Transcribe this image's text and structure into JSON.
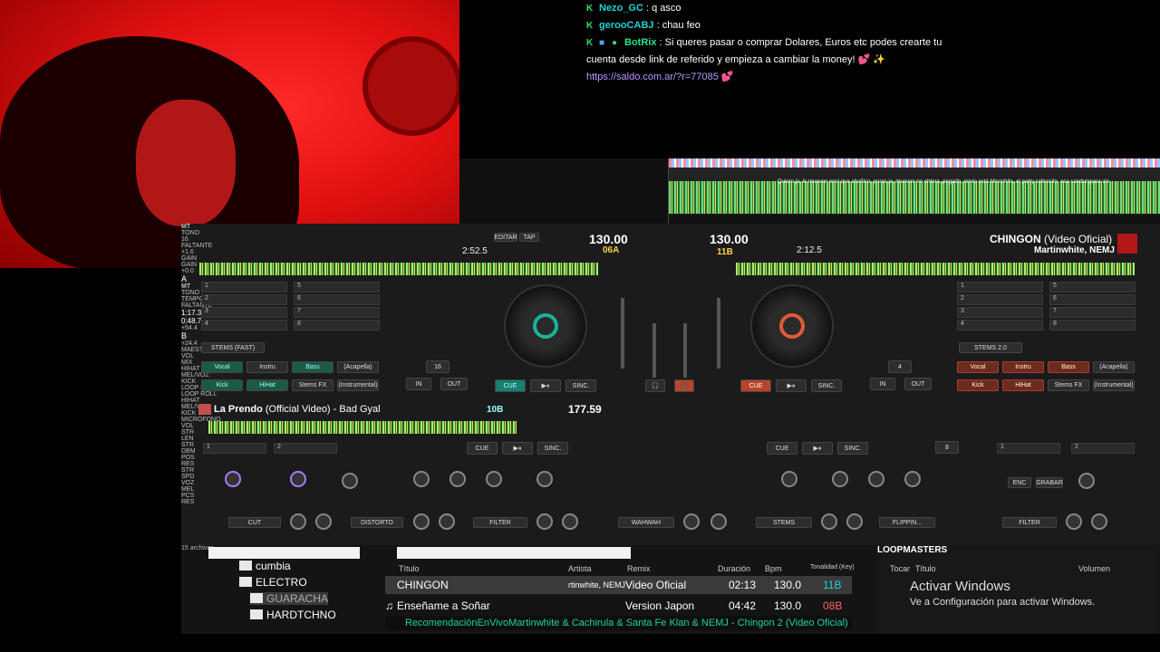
{
  "chat": {
    "messages": [
      {
        "user": "Nezo_GC",
        "text": ": q asco"
      },
      {
        "user": "gerooCABJ",
        "text": ": chau feo"
      },
      {
        "user": "BotRix",
        "text": ": Si queres pasar o comprar Dolares, Euros etc podes crearte tu cuenta desde link de referido y empieza a cambiar la money!",
        "emote": "💕 ✨"
      }
    ],
    "link": "https://saldo.com.ar/?r=77085",
    "link_emote": "💕"
  },
  "waveform": {
    "lyrics": "Quiero ja, lo mueven enci que abañico, puras ja, muevan no ehtera, pegado, novio está bitcochito, el party sabrosito, esa sandunguea vie"
  },
  "deck_b": {
    "bpm": "130.00",
    "key": "11B",
    "time": "2:12.5",
    "remaining_label": "FALTANTE",
    "title": "CHINGON",
    "title_suffix": "(Video Oficial)",
    "artist": "Martinwhite, NEMJ",
    "pitch": "+0.0",
    "loop": "4",
    "cue": "CUE",
    "play": "▶⏸",
    "sync": "SINC.",
    "in": "IN",
    "out": "OUT",
    "stems_mode": "STEMS 2.0",
    "stems": [
      "Vocal",
      "Instru",
      "Bass",
      "(Acapella)",
      "Kick",
      "HiHat",
      "Stems FX",
      "(Instrumental)"
    ],
    "hotcues": [
      "1",
      "2",
      "3",
      "4",
      "5",
      "6",
      "7",
      "8"
    ],
    "beatjump": "8"
  },
  "deck_a": {
    "time": "2:52.5",
    "bpm": "130.00",
    "key": "06A",
    "mt": "MT",
    "tono": "TONO",
    "edit": "EDITAR",
    "tap": "TAP",
    "beats": "16",
    "pitch": "+1.6",
    "loop": "16",
    "cue": "CUE",
    "play": "▶⏸",
    "sync": "SINC.",
    "in": "IN",
    "out": "OUT",
    "stems_mode": "STEMS (FAST)",
    "stems": [
      "Vocal",
      "Instru",
      "Bass",
      "(Acapella)",
      "Kick",
      "HiHat",
      "Stems FX",
      "(Instrumental)"
    ],
    "hotcues": [
      "1",
      "2",
      "3",
      "4",
      "5",
      "6",
      "7",
      "8"
    ]
  },
  "deck_c": {
    "letter": "A",
    "title": "La Prendo",
    "title_suffix": "(Official Video) - Bad Gyal",
    "mt": "MT",
    "tono": "TONO",
    "key": "10B",
    "bpm": "177.59",
    "tempo_label": "TEMPO",
    "faltante_label": "FALTANTE",
    "tempo": "1:17.3",
    "remaining": "0:48.7",
    "pitch": "+54.4",
    "cue": "CUE",
    "play": "▶⏸",
    "sync": "SINC.",
    "hotcues": [
      "1",
      "2"
    ]
  },
  "deck_d": {
    "letter": "B",
    "pitch": "+24.4",
    "cue": "CUE",
    "play": "▶⏸",
    "sync": "SINC.",
    "loop": "8",
    "hotcues": [
      "1",
      "2"
    ]
  },
  "mixer_labels": {
    "gain": "GAIN",
    "maestro": "MAESTRO",
    "vol": "VOL",
    "mix": "MIX",
    "hihat": "HIHAT",
    "melvoz": "MEL/VOZ",
    "kick": "KICK",
    "loop_roll": "LOOP ROLL",
    "microfono": "MICRÓFONO",
    "enc": "ENC",
    "grabar": "GRABAR",
    "str": "STR",
    "len": "LEN",
    "dbm": "DBM",
    "pos": "POS",
    "res": "RES",
    "spd": "SPD",
    "voz": "VOZ",
    "mel": "MEL",
    "pcs": "PCS",
    "fx": [
      "CUT",
      "DISTORTO",
      "FILTER",
      "WAHWAH",
      "STEMS",
      "FLIPPIN...",
      "FILTER"
    ]
  },
  "browser": {
    "folders": [
      "cumbia",
      "ELECTRO",
      "GUARACHA",
      "HARDTCHNO"
    ],
    "file_count": "15 archivos",
    "columns": [
      "Título",
      "Artista",
      "Remix",
      "Duración",
      "Bpm",
      "Tonalidad (Key)"
    ],
    "rows": [
      {
        "title": "CHINGON",
        "artist": "rtinwhite, NEMJ",
        "remix": "Video Oficial",
        "duration": "02:13",
        "bpm": "130.0",
        "key": "11B"
      },
      {
        "title": "Enseñame a Soñar",
        "artist": "",
        "remix": "Version Japon",
        "duration": "04:42",
        "bpm": "130.0",
        "key": "08B"
      }
    ],
    "ticker": "RecomendaciónEnVivoMartinwhite & Cachirula & Santa Fe Klan & NEMJ - Chingon 2 (Video Oficial)",
    "loopmasters_title": "LOOPMASTERS",
    "loop_columns": [
      "Tocar",
      "Título",
      "Volumen"
    ],
    "activate_title": "Activar Windows",
    "activate_sub": "Ve a Configuración para activar Windows."
  },
  "colors": {
    "deck_a_accent": "#17806f",
    "deck_b_accent": "#b8442a",
    "chat_user": "#1cd3d6",
    "link": "#b899ff"
  }
}
